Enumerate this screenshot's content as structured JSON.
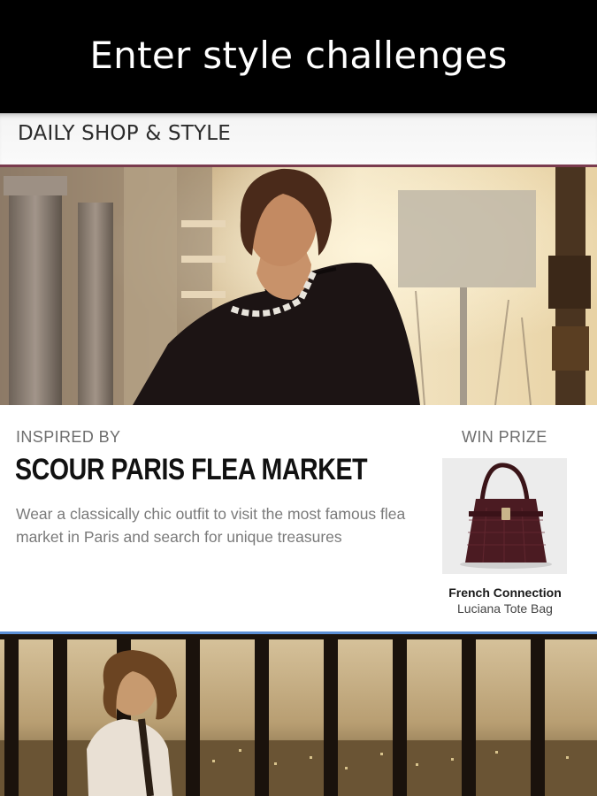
{
  "banner": {
    "text": "Enter style challenges"
  },
  "section": {
    "title": "DAILY SHOP & STYLE"
  },
  "colors": {
    "accent_top": "#7a3b4e",
    "accent_bottom": "#5b8fd6",
    "banner_bg": "#000000"
  },
  "challenge": {
    "label": "INSPIRED BY",
    "title": "SCOUR PARIS FLEA MARKET",
    "description": "Wear a classically chic outfit to visit the most famous flea market in Paris and search for unique treasures"
  },
  "prize": {
    "label": "WIN PRIZE",
    "brand": "French Connection",
    "product": "Luciana Tote Bag",
    "icon": "tote-bag-image"
  },
  "images": {
    "hero": "model-black-sweater-photo",
    "next": "model-city-night-photo"
  }
}
